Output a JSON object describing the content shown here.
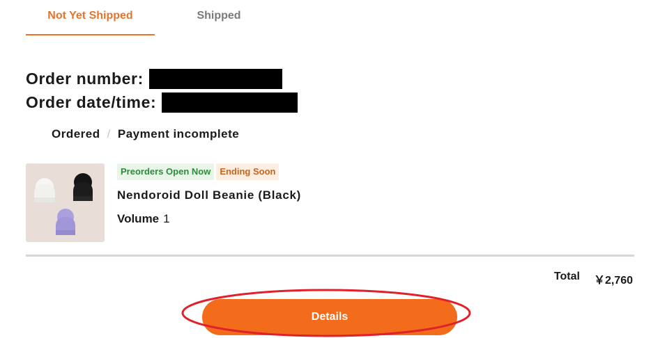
{
  "tabs": {
    "active_label": "Not Yet Shipped",
    "inactive_label": "Shipped"
  },
  "order": {
    "number_label": "Order number:",
    "date_label": "Order date/time:"
  },
  "status": {
    "ordered": "Ordered",
    "separator": "/",
    "payment": "Payment incomplete"
  },
  "product": {
    "badges": [
      "Preorders Open Now",
      "Ending Soon"
    ],
    "name": "Nendoroid Doll Beanie (Black)",
    "volume_label": "Volume",
    "volume_value": "1"
  },
  "summary": {
    "total_label": "Total",
    "total_value": "￥2,760"
  },
  "actions": {
    "details_label": "Details"
  },
  "colors": {
    "accent": "#e8742b",
    "button": "#f36c1c",
    "badge_green_text": "#2e8b3a",
    "badge_orange_text": "#c9641f",
    "annotation_ring": "#e0202a"
  }
}
